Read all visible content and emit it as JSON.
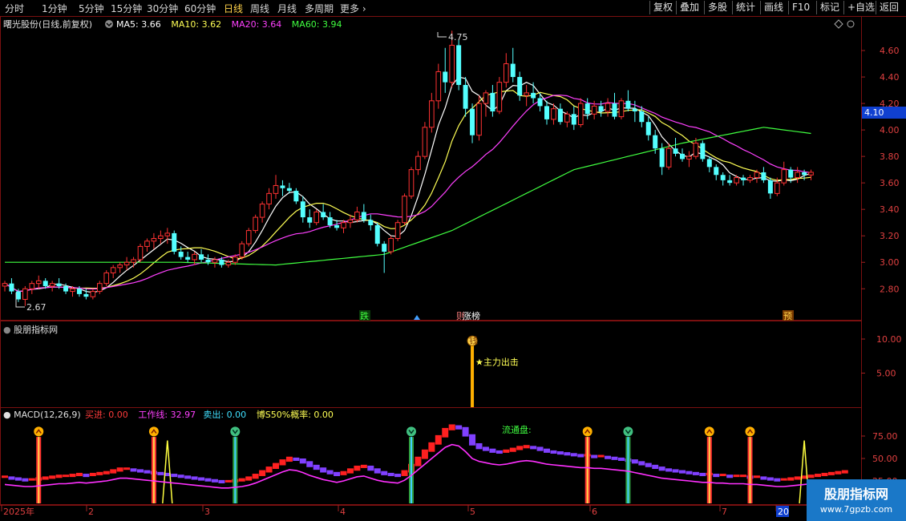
{
  "toolbar": {
    "periods": [
      "分时",
      "1分钟",
      "5分钟",
      "15分钟",
      "30分钟",
      "60分钟",
      "日线",
      "周线",
      "月线",
      "多周期",
      "更多"
    ],
    "active": "日线",
    "right_buttons": [
      "复权",
      "叠加",
      "多股",
      "统计",
      "画线",
      "F10",
      "标记",
      "+自选",
      "返回"
    ]
  },
  "main_panel": {
    "title": "曙光股份(日线,前复权)",
    "ma": [
      {
        "label": "MA5:",
        "value": "3.66",
        "color": "#ffffff"
      },
      {
        "label": "MA10:",
        "value": "3.62",
        "color": "#ffff55"
      },
      {
        "label": "MA20:",
        "value": "3.64",
        "color": "#ff40ff"
      },
      {
        "label": "MA60:",
        "value": "3.94",
        "color": "#40ff40"
      }
    ],
    "y_ticks": [
      "4.60",
      "4.40",
      "4.20",
      "4.00",
      "3.80",
      "3.60",
      "3.40",
      "3.20",
      "3.00",
      "2.80"
    ],
    "price_tag": "4.10",
    "high_label": "4.75",
    "low_label": "2.67",
    "markers": [
      "跌",
      "则",
      "涨榜",
      "预"
    ]
  },
  "indicator_panel": {
    "title": "股朋指标网",
    "y_ticks": [
      "10.00",
      "5.00"
    ],
    "signal_text": "★主力出击",
    "signal_icon": "钱"
  },
  "macd_panel": {
    "title": "MACD(12,26,9)",
    "fields": [
      {
        "label": "买进:",
        "value": "0.00",
        "color": "#ff3b3b"
      },
      {
        "label": "工作线:",
        "value": "32.97",
        "color": "#ff40ff"
      },
      {
        "label": "卖出:",
        "value": "0.00",
        "color": "#40e0ff"
      },
      {
        "label": "博S50%概率:",
        "value": "0.00",
        "color": "#ffff55"
      }
    ],
    "y_ticks": [
      "75.00",
      "50.00",
      "25.00"
    ],
    "annotation": "流通盘:"
  },
  "x_axis": [
    "2025年",
    "2",
    "3",
    "4",
    "5",
    "6",
    "7",
    "20"
  ],
  "watermark": {
    "line1": "股朋指标网",
    "line2": "www.7gpzb.com"
  },
  "chart_data": {
    "type": "candlestick",
    "title": "曙光股份(日线,前复权)",
    "ylim": [
      2.62,
      4.8
    ],
    "candles": [
      [
        2.82,
        2.86,
        2.78,
        2.84
      ],
      [
        2.84,
        2.88,
        2.76,
        2.78
      ],
      [
        2.78,
        2.8,
        2.7,
        2.72
      ],
      [
        2.72,
        2.82,
        2.67,
        2.8
      ],
      [
        2.8,
        2.86,
        2.76,
        2.84
      ],
      [
        2.84,
        2.9,
        2.8,
        2.86
      ],
      [
        2.86,
        2.88,
        2.8,
        2.82
      ],
      [
        2.82,
        2.86,
        2.78,
        2.84
      ],
      [
        2.84,
        2.88,
        2.8,
        2.82
      ],
      [
        2.82,
        2.84,
        2.76,
        2.78
      ],
      [
        2.78,
        2.82,
        2.74,
        2.8
      ],
      [
        2.8,
        2.82,
        2.74,
        2.76
      ],
      [
        2.76,
        2.8,
        2.72,
        2.74
      ],
      [
        2.74,
        2.8,
        2.72,
        2.78
      ],
      [
        2.78,
        2.86,
        2.76,
        2.84
      ],
      [
        2.84,
        2.94,
        2.82,
        2.92
      ],
      [
        2.92,
        2.98,
        2.88,
        2.96
      ],
      [
        2.96,
        3.0,
        2.92,
        2.98
      ],
      [
        2.98,
        3.04,
        2.94,
        3.0
      ],
      [
        3.0,
        3.04,
        2.96,
        3.02
      ],
      [
        3.02,
        3.14,
        3.0,
        3.12
      ],
      [
        3.12,
        3.18,
        3.08,
        3.16
      ],
      [
        3.16,
        3.22,
        3.1,
        3.18
      ],
      [
        3.18,
        3.24,
        3.14,
        3.2
      ],
      [
        3.2,
        3.26,
        3.14,
        3.22
      ],
      [
        3.22,
        3.24,
        3.06,
        3.08
      ],
      [
        3.08,
        3.12,
        3.02,
        3.04
      ],
      [
        3.04,
        3.08,
        3.0,
        3.02
      ],
      [
        3.02,
        3.08,
        2.98,
        3.06
      ],
      [
        3.06,
        3.1,
        3.0,
        3.02
      ],
      [
        3.02,
        3.06,
        2.98,
        3.0
      ],
      [
        3.0,
        3.04,
        2.96,
        3.02
      ],
      [
        3.02,
        3.04,
        2.96,
        2.98
      ],
      [
        2.98,
        3.02,
        2.96,
        3.0
      ],
      [
        3.0,
        3.06,
        2.98,
        3.04
      ],
      [
        3.04,
        3.16,
        3.02,
        3.14
      ],
      [
        3.14,
        3.26,
        3.12,
        3.24
      ],
      [
        3.24,
        3.36,
        3.22,
        3.34
      ],
      [
        3.34,
        3.46,
        3.3,
        3.44
      ],
      [
        3.44,
        3.56,
        3.4,
        3.52
      ],
      [
        3.52,
        3.66,
        3.48,
        3.58
      ],
      [
        3.58,
        3.62,
        3.5,
        3.56
      ],
      [
        3.56,
        3.6,
        3.52,
        3.54
      ],
      [
        3.54,
        3.56,
        3.44,
        3.46
      ],
      [
        3.46,
        3.5,
        3.3,
        3.34
      ],
      [
        3.34,
        3.4,
        3.26,
        3.3
      ],
      [
        3.3,
        3.4,
        3.28,
        3.38
      ],
      [
        3.38,
        3.44,
        3.32,
        3.34
      ],
      [
        3.34,
        3.38,
        3.26,
        3.28
      ],
      [
        3.28,
        3.32,
        3.24,
        3.26
      ],
      [
        3.26,
        3.32,
        3.22,
        3.3
      ],
      [
        3.3,
        3.36,
        3.26,
        3.32
      ],
      [
        3.32,
        3.42,
        3.3,
        3.38
      ],
      [
        3.38,
        3.44,
        3.3,
        3.32
      ],
      [
        3.32,
        3.36,
        3.24,
        3.28
      ],
      [
        3.28,
        3.3,
        3.12,
        3.14
      ],
      [
        3.14,
        3.16,
        2.92,
        3.08
      ],
      [
        3.08,
        3.2,
        3.06,
        3.18
      ],
      [
        3.18,
        3.32,
        3.16,
        3.3
      ],
      [
        3.3,
        3.52,
        3.28,
        3.5
      ],
      [
        3.5,
        3.72,
        3.48,
        3.7
      ],
      [
        3.7,
        3.84,
        3.66,
        3.8
      ],
      [
        3.8,
        4.06,
        3.78,
        4.02
      ],
      [
        4.02,
        4.28,
        3.98,
        4.22
      ],
      [
        4.22,
        4.5,
        4.16,
        4.44
      ],
      [
        4.44,
        4.62,
        4.28,
        4.36
      ],
      [
        4.36,
        4.75,
        4.32,
        4.64
      ],
      [
        4.64,
        4.68,
        4.3,
        4.34
      ],
      [
        4.34,
        4.4,
        4.1,
        4.16
      ],
      [
        4.16,
        4.2,
        3.9,
        3.96
      ],
      [
        3.96,
        4.26,
        3.92,
        4.2
      ],
      [
        4.2,
        4.3,
        4.1,
        4.28
      ],
      [
        4.28,
        4.34,
        4.1,
        4.14
      ],
      [
        4.14,
        4.4,
        4.12,
        4.36
      ],
      [
        4.36,
        4.58,
        4.32,
        4.5
      ],
      [
        4.5,
        4.62,
        4.36,
        4.4
      ],
      [
        4.4,
        4.44,
        4.22,
        4.26
      ],
      [
        4.26,
        4.34,
        4.18,
        4.28
      ],
      [
        4.28,
        4.36,
        4.2,
        4.24
      ],
      [
        4.24,
        4.28,
        4.14,
        4.18
      ],
      [
        4.18,
        4.22,
        4.04,
        4.08
      ],
      [
        4.08,
        4.2,
        4.04,
        4.16
      ],
      [
        4.16,
        4.2,
        4.04,
        4.06
      ],
      [
        4.06,
        4.14,
        4.02,
        4.12
      ],
      [
        4.12,
        4.18,
        4.0,
        4.04
      ],
      [
        4.04,
        4.24,
        4.02,
        4.2
      ],
      [
        4.2,
        4.24,
        4.08,
        4.12
      ],
      [
        4.12,
        4.22,
        4.08,
        4.18
      ],
      [
        4.18,
        4.22,
        4.1,
        4.14
      ],
      [
        4.14,
        4.24,
        4.1,
        4.2
      ],
      [
        4.2,
        4.28,
        4.08,
        4.1
      ],
      [
        4.1,
        4.24,
        4.08,
        4.22
      ],
      [
        4.22,
        4.3,
        4.14,
        4.16
      ],
      [
        4.16,
        4.22,
        4.06,
        4.14
      ],
      [
        4.14,
        4.18,
        4.02,
        4.06
      ],
      [
        4.06,
        4.1,
        3.92,
        3.96
      ],
      [
        3.96,
        4.0,
        3.82,
        3.86
      ],
      [
        3.86,
        3.9,
        3.66,
        3.72
      ],
      [
        3.72,
        3.9,
        3.7,
        3.86
      ],
      [
        3.86,
        3.94,
        3.8,
        3.82
      ],
      [
        3.82,
        3.86,
        3.76,
        3.78
      ],
      [
        3.78,
        3.84,
        3.72,
        3.8
      ],
      [
        3.8,
        3.94,
        3.78,
        3.9
      ],
      [
        3.9,
        3.92,
        3.76,
        3.78
      ],
      [
        3.78,
        3.8,
        3.68,
        3.72
      ],
      [
        3.72,
        3.74,
        3.62,
        3.66
      ],
      [
        3.66,
        3.68,
        3.58,
        3.62
      ],
      [
        3.62,
        3.66,
        3.58,
        3.6
      ],
      [
        3.6,
        3.66,
        3.58,
        3.64
      ],
      [
        3.64,
        3.66,
        3.58,
        3.62
      ],
      [
        3.62,
        3.66,
        3.6,
        3.64
      ],
      [
        3.64,
        3.7,
        3.6,
        3.68
      ],
      [
        3.68,
        3.72,
        3.6,
        3.62
      ],
      [
        3.62,
        3.64,
        3.48,
        3.52
      ],
      [
        3.52,
        3.64,
        3.5,
        3.6
      ],
      [
        3.6,
        3.76,
        3.58,
        3.7
      ],
      [
        3.7,
        3.72,
        3.6,
        3.64
      ],
      [
        3.64,
        3.72,
        3.6,
        3.68
      ],
      [
        3.68,
        3.7,
        3.62,
        3.66
      ],
      [
        3.66,
        3.7,
        3.62,
        3.68
      ]
    ],
    "ma60_anchors": [
      [
        0,
        3.0
      ],
      [
        26,
        3.0
      ],
      [
        40,
        2.98
      ],
      [
        56,
        3.06
      ],
      [
        66,
        3.24
      ],
      [
        84,
        3.7
      ],
      [
        100,
        3.9
      ],
      [
        112,
        4.02
      ],
      [
        124,
        3.94
      ]
    ],
    "indicator": {
      "ylim": [
        0,
        12
      ],
      "spike_index": 69,
      "spike_value": 9.5
    },
    "macd": {
      "ylim": [
        0,
        100
      ],
      "work_line": [
        27,
        26,
        25,
        24,
        24,
        25,
        26,
        27,
        28,
        28,
        29,
        30,
        29,
        30,
        31,
        32,
        34,
        36,
        36,
        35,
        34,
        33,
        32,
        31,
        30,
        29,
        28,
        27,
        26,
        25,
        24,
        23,
        22,
        22,
        23,
        24,
        26,
        29,
        33,
        37,
        41,
        45,
        48,
        47,
        44,
        40,
        37,
        34,
        32,
        30,
        32,
        35,
        38,
        39,
        36,
        33,
        31,
        30,
        29,
        33,
        40,
        48,
        56,
        64,
        72,
        80,
        84,
        82,
        74,
        64,
        60,
        58,
        56,
        55,
        56,
        58,
        60,
        61,
        60,
        58,
        56,
        55,
        54,
        53,
        52,
        51,
        51,
        50,
        50,
        49,
        48,
        47,
        46,
        44,
        42,
        40,
        38,
        36,
        35,
        34,
        33,
        32,
        31,
        30,
        30,
        29,
        29,
        28,
        28,
        28,
        27,
        27,
        26,
        25,
        24,
        24,
        25,
        26,
        27,
        28,
        29,
        30,
        31,
        32,
        33
      ],
      "buy_signals": [
        5,
        22,
        86,
        104,
        110
      ],
      "sell_signals": [
        34,
        60,
        92
      ],
      "yellow_peaks": [
        24,
        118
      ]
    }
  }
}
